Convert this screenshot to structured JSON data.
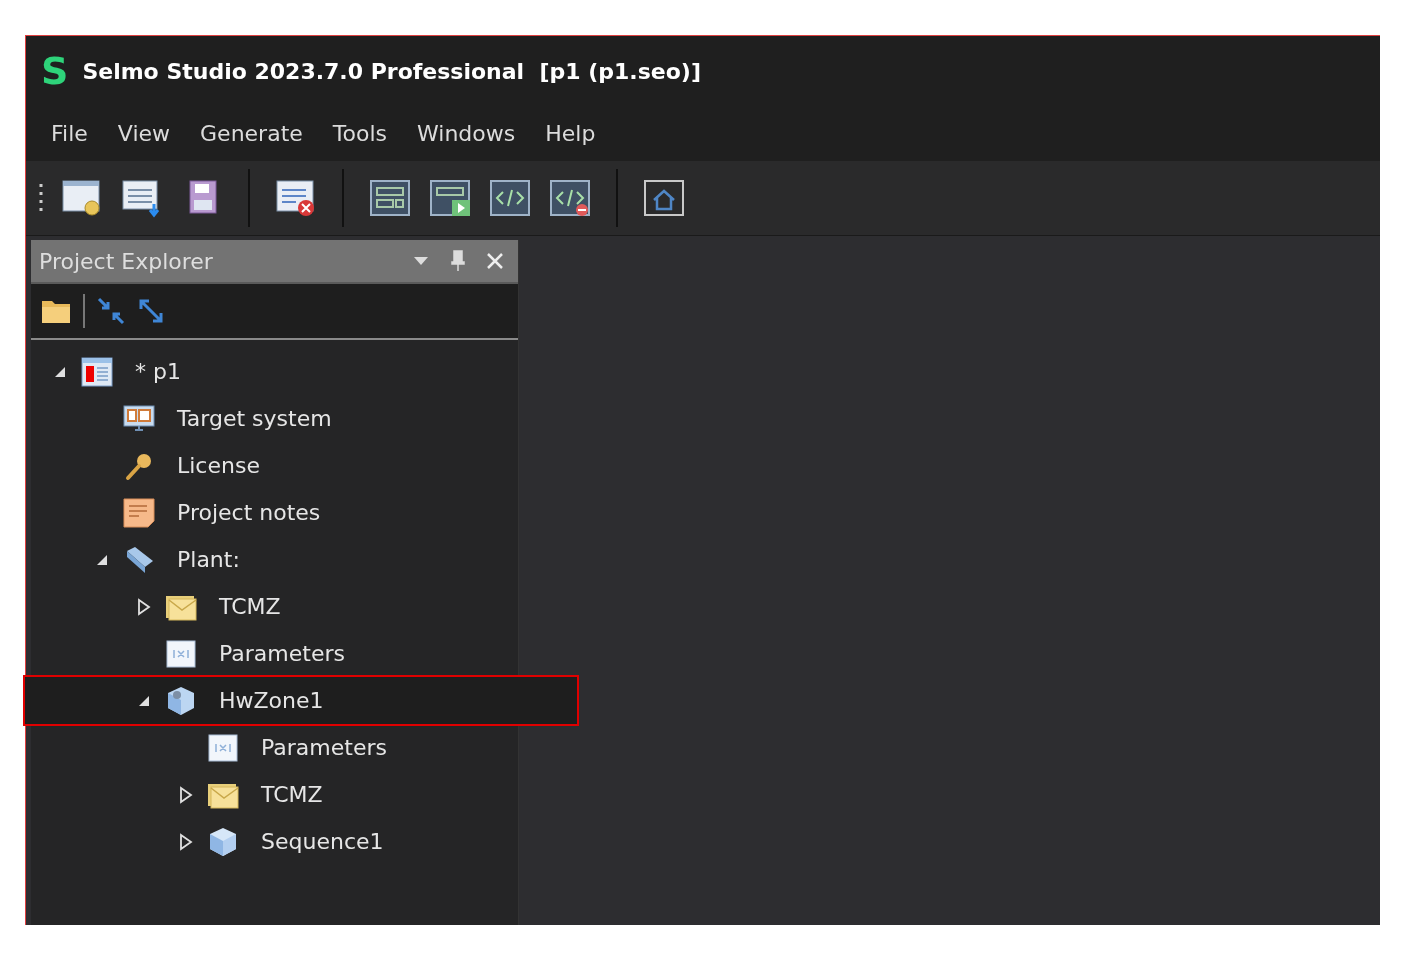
{
  "window": {
    "logo_letter": "S",
    "title": "Selmo Studio 2023.7.0 Professional  [p1 (p1.seo)]"
  },
  "menu": [
    "File",
    "View",
    "Generate",
    "Tools",
    "Windows",
    "Help"
  ],
  "panel": {
    "title": "Project Explorer"
  },
  "tree": [
    {
      "label": "* p1",
      "kind": "project",
      "expanded": true,
      "highlighted": false,
      "children": [
        {
          "label": "Target system",
          "kind": "target",
          "highlighted": false
        },
        {
          "label": "License",
          "kind": "key",
          "highlighted": false
        },
        {
          "label": "Project notes",
          "kind": "note",
          "highlighted": false
        },
        {
          "label": "Plant:",
          "kind": "plant",
          "expanded": true,
          "highlighted": false,
          "children": [
            {
              "label": "TCMZ",
              "kind": "folder",
              "expanded": false,
              "highlighted": false
            },
            {
              "label": "Parameters",
              "kind": "params",
              "highlighted": false
            },
            {
              "label": "HwZone1",
              "kind": "zone",
              "expanded": true,
              "highlighted": true,
              "children": [
                {
                  "label": "Parameters",
                  "kind": "params",
                  "highlighted": false
                },
                {
                  "label": "TCMZ",
                  "kind": "folder",
                  "expanded": false,
                  "highlighted": false
                },
                {
                  "label": "Sequence1",
                  "kind": "cube",
                  "expanded": false,
                  "highlighted": false
                }
              ]
            }
          ]
        }
      ]
    }
  ]
}
